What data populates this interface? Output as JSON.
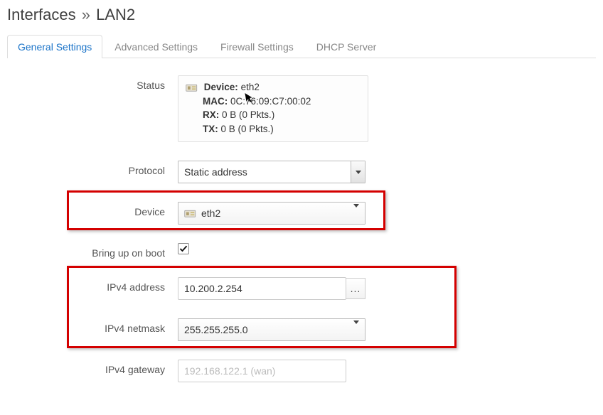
{
  "title": {
    "main": "Interfaces",
    "sep": "»",
    "sub": "LAN2"
  },
  "tabs": [
    {
      "label": "General Settings",
      "active": true
    },
    {
      "label": "Advanced Settings",
      "active": false
    },
    {
      "label": "Firewall Settings",
      "active": false
    },
    {
      "label": "DHCP Server",
      "active": false
    }
  ],
  "labels": {
    "status": "Status",
    "protocol": "Protocol",
    "device": "Device",
    "bring_up": "Bring up on boot",
    "ipv4_addr": "IPv4 address",
    "ipv4_mask": "IPv4 netmask",
    "ipv4_gw": "IPv4 gateway"
  },
  "status": {
    "device_label": "Device:",
    "device_value": "eth2",
    "mac_label": "MAC:",
    "mac_value": "0C:76:09:C7:00:02",
    "rx_label": "RX:",
    "rx_value": "0 B (0 Pkts.)",
    "tx_label": "TX:",
    "tx_value": "0 B (0 Pkts.)"
  },
  "protocol": {
    "selected": "Static address"
  },
  "device": {
    "selected": "eth2"
  },
  "bring_up_on_boot": true,
  "ipv4_address": {
    "value": "10.200.2.254",
    "addon": "..."
  },
  "ipv4_netmask": {
    "selected": "255.255.255.0"
  },
  "ipv4_gateway": {
    "placeholder": "192.168.122.1 (wan)"
  }
}
